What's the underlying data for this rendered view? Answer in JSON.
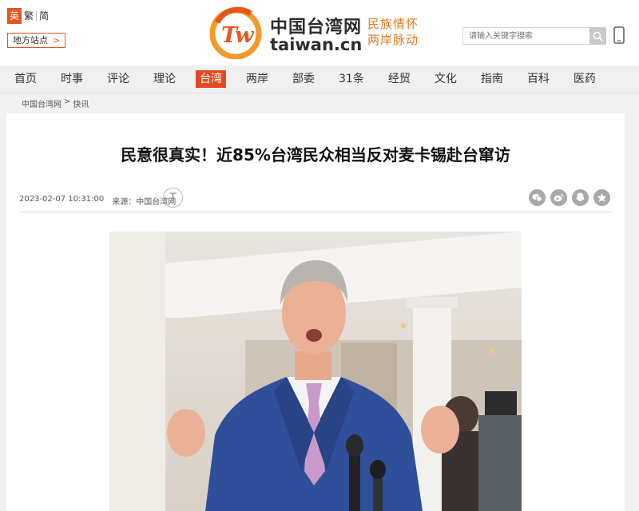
{
  "header": {
    "lang": {
      "en": "英",
      "trad": "繁",
      "simp": "简"
    },
    "local_sites": "地方站点",
    "logo": {
      "cn": "中国台湾网",
      "en": "taiwan.cn",
      "slogan_line1": "民族情怀",
      "slogan_line2": "两岸脉动"
    },
    "search_placeholder": "请输入关键字搜索"
  },
  "nav": {
    "items": [
      {
        "label": "首页"
      },
      {
        "label": "时事"
      },
      {
        "label": "评论"
      },
      {
        "label": "理论"
      },
      {
        "label": "台湾",
        "active": true
      },
      {
        "label": "两岸"
      },
      {
        "label": "部委"
      },
      {
        "label": "31条"
      },
      {
        "label": "经贸"
      },
      {
        "label": "文化"
      },
      {
        "label": "指南"
      },
      {
        "label": "百科"
      },
      {
        "label": "医药"
      }
    ]
  },
  "breadcrumb": {
    "home": "中国台湾网",
    "sep": ">",
    "current": "快讯"
  },
  "article": {
    "title": "民意很真实！近85%台湾民众相当反对麦卡锡赴台窜访",
    "date": "2023-02-07 10:31:00",
    "source": "来源：中国台湾网",
    "font_toggle": "T"
  },
  "colors": {
    "brand": "#e8551d",
    "nav_active": "#e14a22",
    "slogan": "#e07b20"
  },
  "icons": [
    "search-icon",
    "phone-icon",
    "wechat-icon",
    "weibo-icon",
    "qq-icon",
    "favorite-icon"
  ]
}
